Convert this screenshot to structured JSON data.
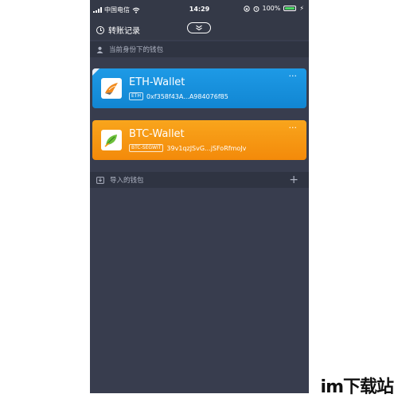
{
  "status_bar": {
    "carrier": "中国电信",
    "time": "14:29",
    "battery": "100%",
    "battery_level": 1.0
  },
  "nav": {
    "history_label": "转账记录"
  },
  "sections": {
    "current_identity": "当前身份下的钱包",
    "imported": "导入的钱包"
  },
  "wallets": [
    {
      "name": "ETH-Wallet",
      "tag": "ETH",
      "address": "0xf358f43A...A984076f85",
      "color": "#1a93de"
    },
    {
      "name": "BTC-Wallet",
      "tag": "BTC-SEGWIT",
      "address": "39v1qzJSvG...jSFoRfmoJv",
      "color": "#f7990f"
    }
  ],
  "more_glyph": "···",
  "add_glyph": "+",
  "watermark": "im下载站",
  "colors": {
    "background": "#383d4e",
    "header": "#343947",
    "section": "#2f3442"
  }
}
